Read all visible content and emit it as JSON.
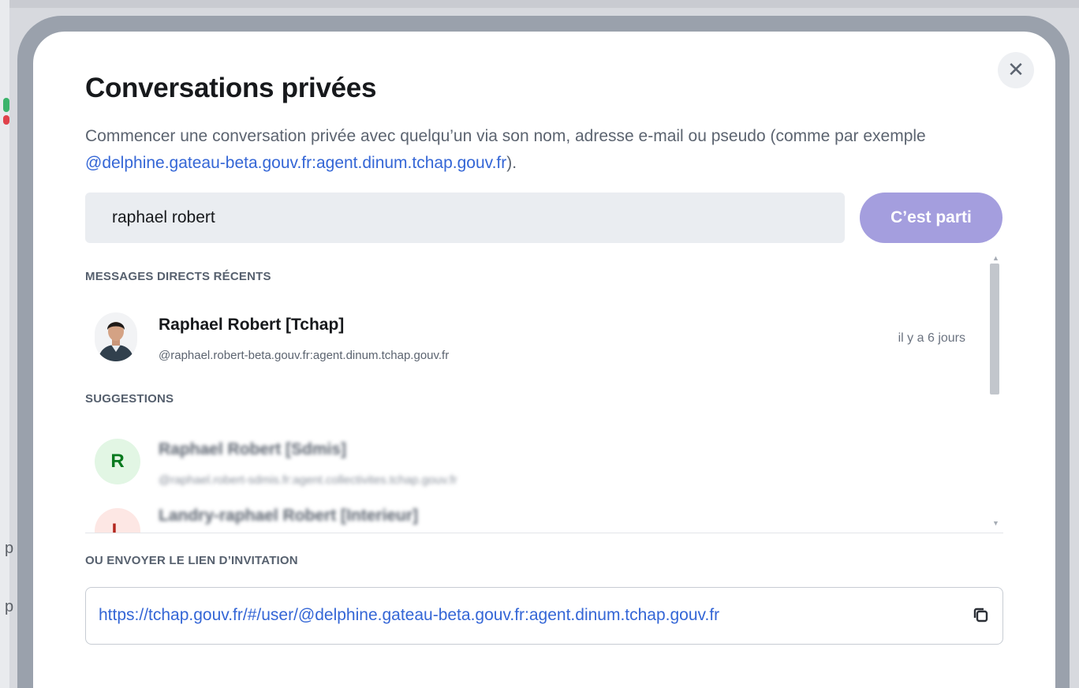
{
  "background": {
    "letters": [
      "p",
      "p"
    ]
  },
  "dialog": {
    "title": "Conversations privées",
    "close_icon": "close-icon",
    "description": {
      "text_before": "Commencer une conversation privée avec quelqu’un via son nom, adresse e-mail ou pseudo (comme par exemple ",
      "example_handle": "@delphine.gateau-beta.gouv.fr:agent.dinum.tchap.gouv.fr",
      "text_after": ")."
    },
    "search": {
      "value": "raphael robert"
    },
    "go_button_label": "C’est parti",
    "recent": {
      "section_title": "MESSAGES DIRECTS RÉCENTS",
      "items": [
        {
          "name": "Raphael Robert [Tchap]",
          "handle": "@raphael.robert-beta.gouv.fr:agent.dinum.tchap.gouv.fr",
          "time": "il y a 6 jours"
        }
      ]
    },
    "suggestions": {
      "section_title": "SUGGESTIONS",
      "items": [
        {
          "initial": "R",
          "name": "Raphael Robert [Sdmis]",
          "handle": "@raphael.robert-sdmis.fr:agent.collectivites.tchap.gouv.fr",
          "color": "#0a7a1f",
          "bg": "#e2f6e4"
        },
        {
          "initial": "L",
          "name": "Landry-raphael Robert [Interieur]",
          "handle": "",
          "color": "#b3261e",
          "bg": "#fde7e4"
        }
      ]
    },
    "invite": {
      "section_title": "OU ENVOYER LE LIEN D’INVITATION",
      "link": "https://tchap.gouv.fr/#/user/@delphine.gateau-beta.gouv.fr:agent.dinum.tchap.gouv.fr",
      "copy_icon": "copy-icon"
    }
  }
}
